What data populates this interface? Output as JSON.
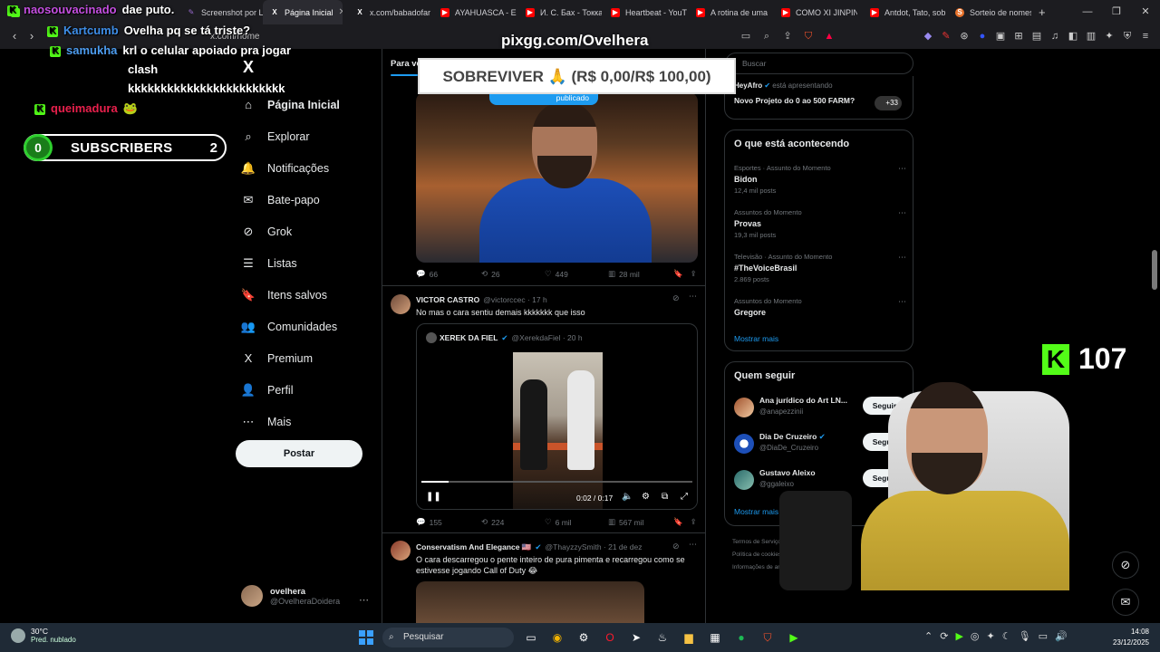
{
  "browser": {
    "tabs": [
      {
        "label": "naosouvacinado",
        "color": "#53fc18",
        "fav": "K"
      },
      {
        "label": "Screenshot por L",
        "color": "#9a6bd0",
        "fav": "✎"
      },
      {
        "label": "Página Inicial",
        "color": "#ffffff",
        "fav": "X"
      },
      {
        "label": "x.com/babadofar",
        "color": "#ffffff",
        "fav": "X"
      },
      {
        "label": "AYAHUASCA - EM",
        "color": "#ff0000",
        "fav": "▶"
      },
      {
        "label": "И. С. Бах - Токка",
        "color": "#ff0000",
        "fav": "▶"
      },
      {
        "label": "Heartbeat - YouT",
        "color": "#ff0000",
        "fav": "▶"
      },
      {
        "label": "A rotina de uma",
        "color": "#ff0000",
        "fav": "▶"
      },
      {
        "label": "COMO XI JINPIN",
        "color": "#ff0000",
        "fav": "▶"
      },
      {
        "label": "Antdot, Tato, sob",
        "color": "#ff0000",
        "fav": "▶"
      },
      {
        "label": "Sorteio de nomes",
        "color": "#e8722b",
        "fav": "S"
      }
    ],
    "url": "x.com/home",
    "new_tab": "+"
  },
  "overlay": {
    "chat": [
      {
        "user": "naosouvacinado",
        "user_color": "#c44fe0",
        "message": "dae puto."
      },
      {
        "user": "Kartcumb",
        "user_color": "#3e8ee8",
        "message": "Ovelha pq se tá triste?"
      },
      {
        "user": "samukha",
        "user_color": "#4d9df0",
        "message": "krl o celular apoiado pra jogar"
      },
      {
        "user": "",
        "user_color": "#ffffff",
        "message": "clash"
      },
      {
        "user": "",
        "user_color": "#ffffff",
        "message": "kkkkkkkkkkkkkkkkkkkkkkkk"
      },
      {
        "user": "queimadura",
        "user_color": "#e8204c",
        "message": "🐸"
      }
    ],
    "subs_current": "0",
    "subs_label": "SUBSCRIBERS",
    "subs_goal": "2",
    "pix": "pixgg.com/Ovelhera",
    "goal_text": "SOBREVIVER 🙏 (R$ 0,00/R$ 100,00)",
    "viewer_count": "107",
    "kick_logo": "K"
  },
  "nav": {
    "logo": "X",
    "items": [
      {
        "label": "Página Inicial",
        "icon": "⌂"
      },
      {
        "label": "Explorar",
        "icon": "⌕"
      },
      {
        "label": "Notificações",
        "icon": "🔔"
      },
      {
        "label": "Bate-papo",
        "icon": "✉"
      },
      {
        "label": "Grok",
        "icon": "⊘"
      },
      {
        "label": "Listas",
        "icon": "☰"
      },
      {
        "label": "Itens salvos",
        "icon": "🔖"
      },
      {
        "label": "Comunidades",
        "icon": "👥"
      },
      {
        "label": "Premium",
        "icon": "X"
      },
      {
        "label": "Perfil",
        "icon": "👤"
      },
      {
        "label": "Mais",
        "icon": "⋯"
      }
    ],
    "post_button": "Postar",
    "profile_name": "ovelhera",
    "profile_handle": "@OvelheraDoidera",
    "profile_more": "⋯"
  },
  "feed": {
    "tab": "Para vc",
    "posted_pill": "publicado",
    "tweet1_actions": {
      "replies": "66",
      "reposts": "26",
      "likes": "449",
      "views": "28 mil"
    },
    "tweet2": {
      "name": "VICTOR CASTRO",
      "handle": "@victorccec · 17 h",
      "text": "No mas o cara sentiu demais kkkkkkk que isso",
      "quote_name": "XEREK DA FIEL",
      "quote_handle": "@XerekdaFiel · 20 h",
      "video_time": "0:02 / 0:17",
      "actions": {
        "replies": "155",
        "reposts": "224",
        "likes": "6 mil",
        "views": "567 mil"
      }
    },
    "tweet3": {
      "name": "Conservatism And Elegance 🇺🇸",
      "handle": "@ThayzzySmith · 21 de dez",
      "text": "O cara descarregou o pente inteiro de pura pimenta e recarregou como se estivesse jogando Call of Duty 😂"
    }
  },
  "right": {
    "search_placeholder": "Buscar",
    "live_user": "HeyAfro",
    "live_status": "está apresentando",
    "live_title": "Novo Projeto do 0 ao 500 FARM?",
    "live_count": "+33",
    "trending_title": "O que está acontecendo",
    "trends": [
      {
        "category": "Esportes · Assunto do Momento",
        "title": "Bidon",
        "posts": "12,4 mil posts"
      },
      {
        "category": "Assuntos do Momento",
        "title": "Provas",
        "posts": "19,3 mil posts"
      },
      {
        "category": "Televisão · Assunto do Momento",
        "title": "#TheVoiceBrasil",
        "posts": "2.869 posts"
      },
      {
        "category": "Assuntos do Momento",
        "title": "Gregore",
        "posts": ""
      }
    ],
    "show_more": "Mostrar mais",
    "who_to_follow_title": "Quem seguir",
    "follow": [
      {
        "name": "Ana jurídico do Art LN...",
        "handle": "@anapezzinii",
        "button": "Seguir"
      },
      {
        "name": "Dia De Cruzeiro",
        "handle": "@DiaDe_Cruzeiro",
        "button": "Seguir"
      },
      {
        "name": "Gustavo Aleixo",
        "handle": "@ggaleixo",
        "button": "Seguir"
      }
    ],
    "footer": [
      "Termos de Serviço",
      "Política de cookies",
      "Informações de anúncios"
    ]
  },
  "taskbar": {
    "temp": "30°C",
    "weather": "Pred. nublado",
    "search": "Pesquisar",
    "time": "14:08",
    "date": "23/12/2025"
  }
}
